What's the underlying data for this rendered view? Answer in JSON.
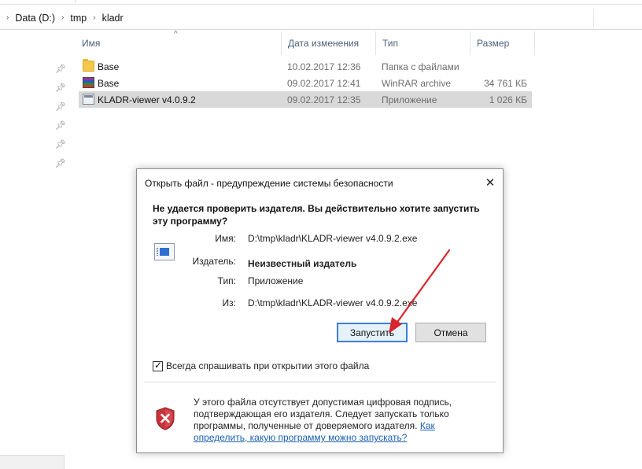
{
  "explorer": {
    "breadcrumb": [
      "Data (D:)",
      "tmp",
      "kladr"
    ],
    "columns": {
      "name": "Имя",
      "date": "Дата изменения",
      "type": "Тип",
      "size": "Размер"
    },
    "files": [
      {
        "name": "Base",
        "date": "10.02.2017 12:36",
        "type": "Папка с файлами",
        "size": "",
        "icon": "folder-icon"
      },
      {
        "name": "Base",
        "date": "09.02.2017 12:41",
        "type": "WinRAR archive",
        "size": "34 761 КБ",
        "icon": "winrar-archive-icon"
      },
      {
        "name": "KLADR-viewer v4.0.9.2",
        "date": "09.02.2017 12:35",
        "type": "Приложение",
        "size": "1 026 КБ",
        "icon": "application-icon"
      }
    ]
  },
  "dialog": {
    "title": "Открыть файл - предупреждение системы безопасности",
    "heading": "Не удается проверить издателя.  Вы действительно хотите запустить эту программу?",
    "fields": {
      "name_label": "Имя:",
      "name_value": "D:\\tmp\\kladr\\KLADR-viewer v4.0.9.2.exe",
      "publisher_label": "Издатель:",
      "publisher_value": "Неизвестный издатель",
      "type_label": "Тип:",
      "type_value": "Приложение",
      "from_label": "Из:",
      "from_value": "D:\\tmp\\kladr\\KLADR-viewer v4.0.9.2.exe"
    },
    "run_button": "Запустить",
    "cancel_button": "Отмена",
    "always_ask_label": "Всегда спрашивать при открытии этого файла",
    "always_ask_checked": true,
    "footer_text": "У этого файла отсутствует допустимая цифровая подпись, подтверждающая его издателя.  Следует запускать только программы, полученные от доверяемого издателя.",
    "footer_link": "Как определить, какую программу можно запускать?",
    "colors": {
      "accent": "#3c7fd6",
      "annotation_arrow": "#d8262c",
      "shield": "#c8333a"
    }
  }
}
